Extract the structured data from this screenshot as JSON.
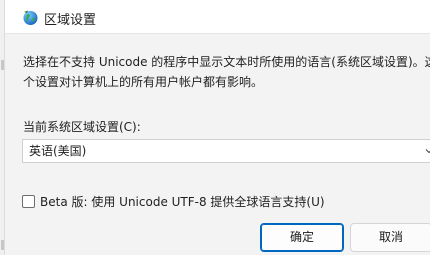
{
  "window": {
    "title": "区域设置",
    "icon": "globe-icon"
  },
  "description": {
    "line1": "选择在不支持 Unicode 的程序中显示文本时所使用的语言(系统区域设置)。这",
    "line2": "个设置对计算机上的所有用户帐户都有影响。"
  },
  "locale": {
    "label": "当前系统区域设置(C):",
    "selected": "英语(美国)"
  },
  "beta": {
    "label": "Beta 版: 使用 Unicode UTF-8 提供全球语言支持(U)",
    "checked": false
  },
  "buttons": {
    "ok": "确定",
    "cancel": "取消"
  },
  "colors": {
    "accent": "#0067c0",
    "background": "#f3f3f3"
  }
}
